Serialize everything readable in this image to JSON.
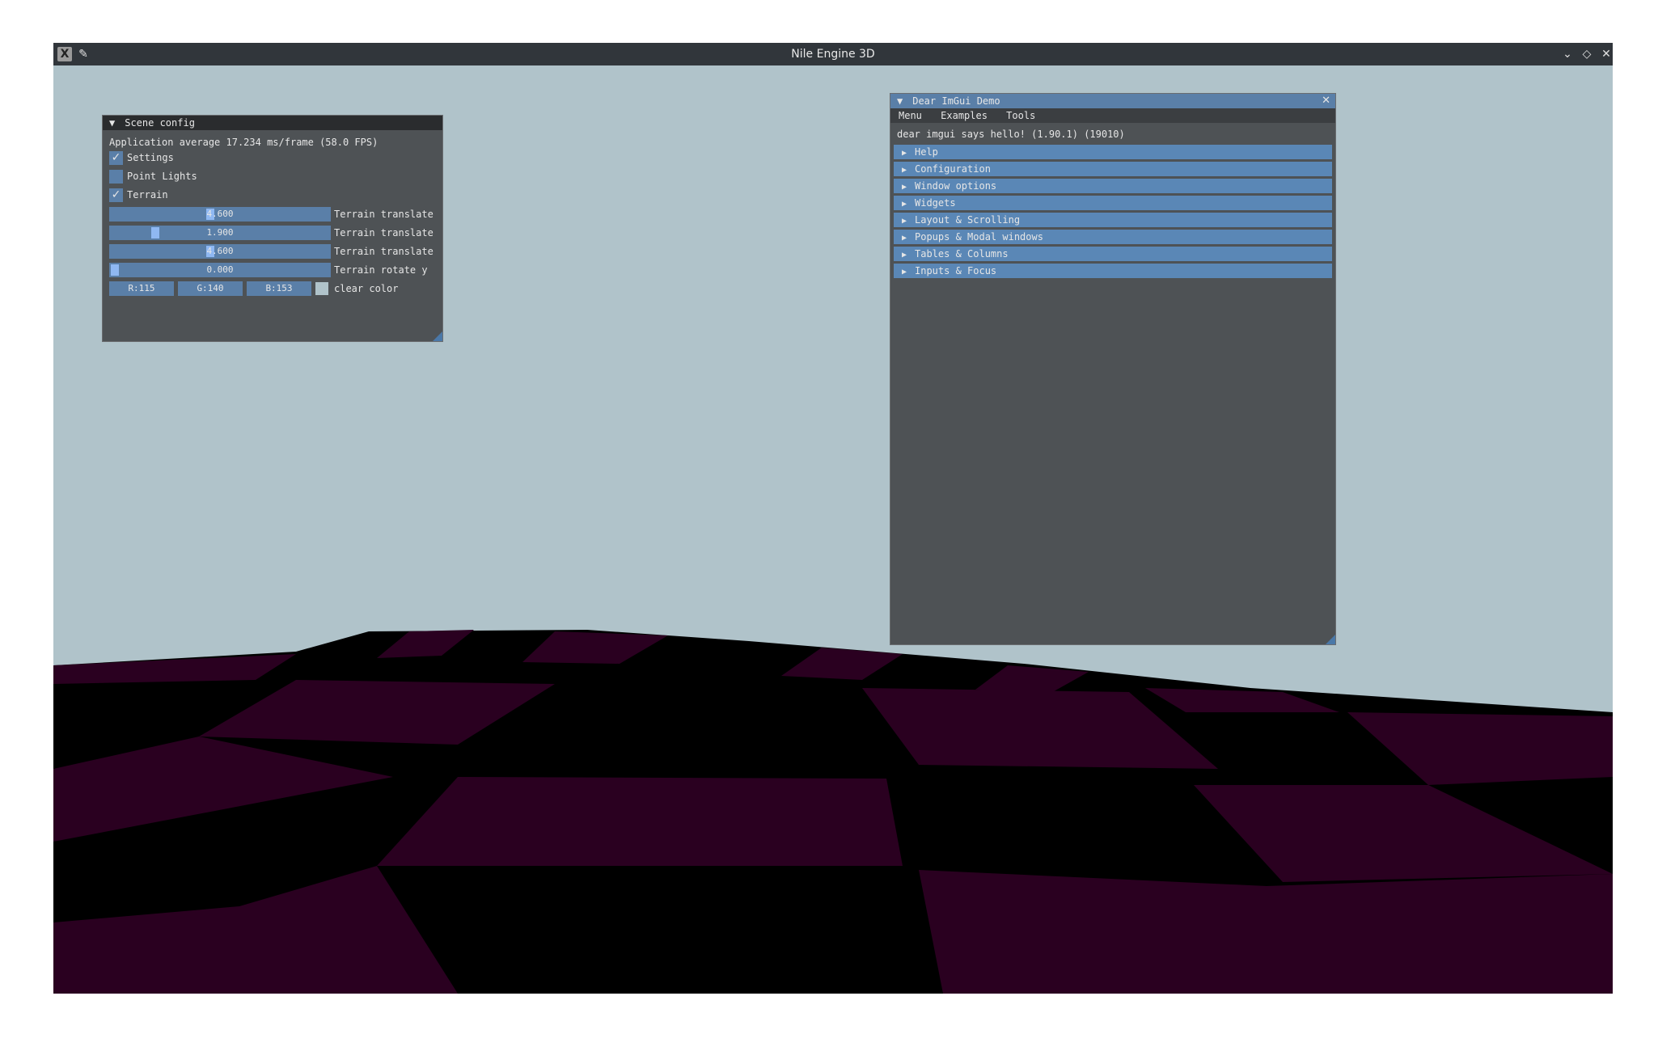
{
  "window": {
    "title": "Nile Engine 3D",
    "icons": [
      "x-logo-icon",
      "pin-icon",
      "minimize-icon",
      "maximize-icon",
      "close-icon"
    ]
  },
  "scene_config": {
    "title": "Scene config",
    "fps_text": "Application average 17.234 ms/frame (58.0 FPS)",
    "checkboxes": [
      {
        "label": "Settings",
        "checked": true
      },
      {
        "label": "Point Lights",
        "checked": false
      },
      {
        "label": "Terrain",
        "checked": true
      }
    ],
    "sliders": [
      {
        "label": "Terrain translate x",
        "value": "4.600"
      },
      {
        "label": "Terrain translate y",
        "value": "1.900"
      },
      {
        "label": "Terrain translate z",
        "value": "4.600"
      },
      {
        "label": "Terrain rotate y",
        "value": "0.000"
      }
    ],
    "clear_color": {
      "r": "R:115",
      "g": "G:140",
      "b": "B:153",
      "label": "clear color",
      "swatch": "#738c99"
    }
  },
  "demo": {
    "title": "Dear ImGui Demo",
    "menu": [
      "Menu",
      "Examples",
      "Tools"
    ],
    "hello": "dear imgui says hello! (1.90.1) (19010)",
    "headers": [
      "Help",
      "Configuration",
      "Window options",
      "Widgets",
      "Layout & Scrolling",
      "Popups & Modal windows",
      "Tables & Columns",
      "Inputs & Focus"
    ]
  },
  "colors": {
    "sky": "#b0c3ca",
    "terrain_dark": "#000000",
    "terrain_purple": "#2a0020",
    "accent": "#5a7fa8"
  }
}
